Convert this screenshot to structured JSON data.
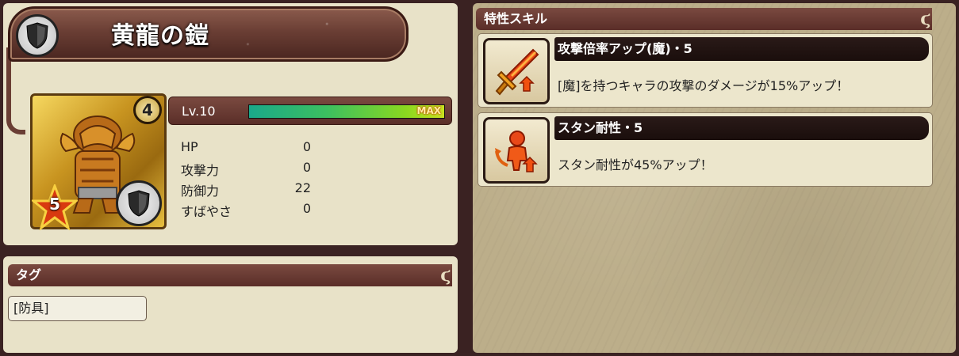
{
  "item": {
    "name": "黄龍の鎧",
    "level_badge": "4",
    "stars": "5",
    "category_icon": "shield-icon"
  },
  "level": {
    "label": "Lv.10",
    "progress": 1.0,
    "max_label": "MAX"
  },
  "stats": [
    {
      "name": "HP",
      "value": "0"
    },
    {
      "name": "攻撃力",
      "value": "0"
    },
    {
      "name": "防御力",
      "value": "22"
    },
    {
      "name": "すばやさ",
      "value": "0"
    }
  ],
  "tags": {
    "header": "タグ",
    "items": [
      "[防具]"
    ]
  },
  "skills": {
    "header": "特性スキル",
    "items": [
      {
        "name": "攻撃倍率アップ(魔)・5",
        "desc": "[魔]を持つキャラの攻撃のダメージが15%アップ！",
        "icon": "flaming-sword-icon"
      },
      {
        "name": "スタン耐性・5",
        "desc": "スタン耐性が45%アップ！",
        "icon": "stun-resist-icon"
      }
    ]
  },
  "colors": {
    "header_bg": "#6a3e34",
    "panel_bg": "#e8e2c8",
    "exp_fill": "#3cc060"
  }
}
